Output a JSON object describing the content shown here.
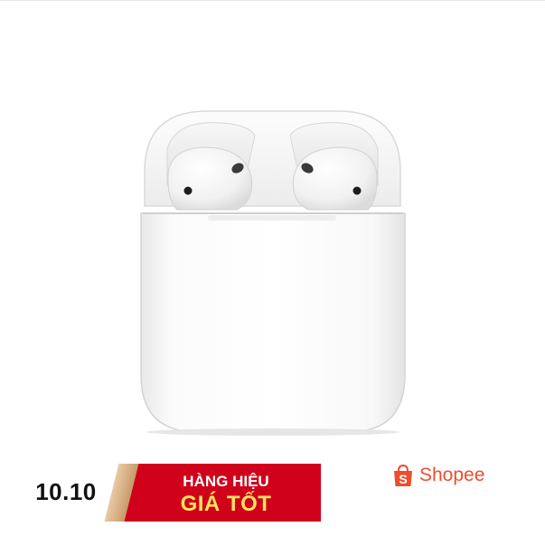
{
  "image": {
    "subject": "product-photo",
    "icon": "earbuds-charging-case-icon"
  },
  "promo_banner": {
    "date": "10.10",
    "line1": "HÀNG HIỆU",
    "line2": "GIÁ TỐT",
    "colors": {
      "background": "#d0011b",
      "line2": "#ffe45c"
    }
  },
  "brand": {
    "name": "Shopee",
    "icon": "shopping-bag-icon",
    "color": "#ee4d2d"
  }
}
